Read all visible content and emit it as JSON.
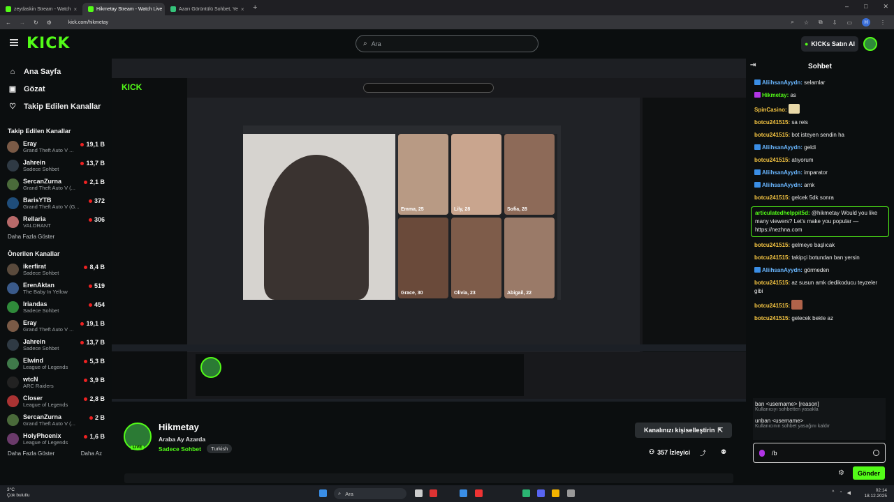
{
  "browser": {
    "tabs": [
      {
        "title": "zeydaskin Stream - Watch",
        "active": false,
        "color": "#53fc18"
      },
      {
        "title": "Hikmetay Stream - Watch Live",
        "active": true,
        "color": "#53fc18"
      },
      {
        "title": "Azarı Görüntülü Sohbet, Ye",
        "active": false,
        "color": "#35c37a"
      }
    ],
    "new_tab": "+",
    "url": "kick.com/hikmetay",
    "window_controls": [
      "–",
      "□",
      "✕"
    ]
  },
  "header": {
    "logo": "KICK",
    "search_placeholder": "Ara",
    "buy_kicks": "KICKs Satın Al"
  },
  "sidebar": {
    "nav": [
      {
        "label": "Ana Sayfa",
        "icon": "home-icon",
        "glyph": "⌂"
      },
      {
        "label": "Gözat",
        "icon": "browse-icon",
        "glyph": "▣"
      },
      {
        "label": "Takip Edilen Kanallar",
        "icon": "heart-icon",
        "glyph": "♡"
      }
    ],
    "followed_heading": "Takip Edilen Kanallar",
    "followed": [
      {
        "name": "Eray",
        "category": "Grand Theft Auto V ...",
        "viewers": "19,1 B",
        "color": "#7a5a46"
      },
      {
        "name": "Jahrein",
        "category": "Sadece Sohbet",
        "viewers": "13,7 B",
        "color": "#2f3a44"
      },
      {
        "name": "SercanZurna",
        "category": "Grand Theft Auto V (...",
        "viewers": "2,1 B",
        "color": "#4a6a3a"
      },
      {
        "name": "BarisYTB",
        "category": "Grand Theft Auto V (G...",
        "viewers": "372",
        "color": "#1f4d7a"
      },
      {
        "name": "Rellaria",
        "category": "VALORANT",
        "viewers": "306",
        "color": "#b86a6a"
      }
    ],
    "followed_more": "Daha Fazla Göster",
    "recommended_heading": "Önerilen Kanallar",
    "recommended": [
      {
        "name": "ikerfirat",
        "category": "Sadece Sohbet",
        "viewers": "8,4 B",
        "color": "#5a4a3c"
      },
      {
        "name": "ErenAktan",
        "category": "The Baby In Yellow",
        "viewers": "519",
        "color": "#3a5a8a"
      },
      {
        "name": "Iriandas",
        "category": "Sadece Sohbet",
        "viewers": "454",
        "color": "#2f8a3a"
      },
      {
        "name": "Eray",
        "category": "Grand Theft Auto V ...",
        "viewers": "19,1 B",
        "color": "#7a5a46"
      },
      {
        "name": "Jahrein",
        "category": "Sadece Sohbet",
        "viewers": "13,7 B",
        "color": "#2f3a44"
      },
      {
        "name": "Elwind",
        "category": "League of Legends",
        "viewers": "5,3 B",
        "color": "#3f7a4a"
      },
      {
        "name": "wtcN",
        "category": "ARC Raiders",
        "viewers": "3,9 B",
        "color": "#222"
      },
      {
        "name": "Closer",
        "category": "League of Legends",
        "viewers": "2,8 B",
        "color": "#a33"
      },
      {
        "name": "SercanZurna",
        "category": "Grand Theft Auto V (...",
        "viewers": "2 B",
        "color": "#4a6a3a"
      },
      {
        "name": "HolyPhoenix",
        "category": "League of Legends",
        "viewers": "1,6 B",
        "color": "#6a3a6a"
      }
    ],
    "recommended_more": "Daha Fazla Göster",
    "recommended_less": "Daha Az"
  },
  "stream": {
    "streamer": "Hikmetay",
    "title": "Araba Ay Azarda",
    "category": "Sadece Sohbet",
    "tag": "Turkish",
    "live": "LIVE",
    "personalize": "Kanalınızı kişiselleştirin",
    "viewers": "357 İzleyici",
    "inner_cards": [
      {
        "name": "Emma, 25"
      },
      {
        "name": "Lily, 28"
      },
      {
        "name": "Sofia, 28"
      },
      {
        "name": "Grace, 30"
      },
      {
        "name": "Olivia, 23"
      },
      {
        "name": "Abigail, 22"
      }
    ]
  },
  "chat": {
    "title": "Sohbet",
    "messages": [
      {
        "user": "AliihsanAyydn",
        "text": "selamlar",
        "color": "#6ab7ff",
        "badge": "#3a8ee6"
      },
      {
        "user": "Hikmetay",
        "text": "as",
        "color": "#53fc18",
        "badge": "#b235e6"
      },
      {
        "user": "SpinCasino",
        "text": "",
        "color": "#f5c542",
        "emote": true
      },
      {
        "user": "botcu241515",
        "text": "sa reis",
        "color": "#f5c542"
      },
      {
        "user": "botcu241515",
        "text": "bot isteyen sendin ha",
        "color": "#f5c542"
      },
      {
        "user": "AliihsanAyydn",
        "text": "geldi",
        "color": "#6ab7ff",
        "badge": "#3a8ee6"
      },
      {
        "user": "botcu241515",
        "text": "atıyorum",
        "color": "#f5c542"
      },
      {
        "user": "AliihsanAyydn",
        "text": "imparator",
        "color": "#6ab7ff",
        "badge": "#3a8ee6"
      },
      {
        "user": "AliihsanAyydn",
        "text": "amk",
        "color": "#6ab7ff",
        "badge": "#3a8ee6"
      },
      {
        "user": "botcu241515",
        "text": "gelcek 5dk sonra",
        "color": "#f5c542"
      },
      {
        "user": "articulatedhelppit5d",
        "text": "@hikmetay Would you like many viewers? Let's make you popular — https://nezhna.com",
        "color": "#53fc18",
        "highlight": true
      },
      {
        "user": "botcu241515",
        "text": "gelmeye başlıcak",
        "color": "#f5c542"
      },
      {
        "user": "botcu241515",
        "text": "takipçi botundan ban yersin",
        "color": "#f5c542"
      },
      {
        "user": "AliihsanAyydn",
        "text": "görmeden",
        "color": "#6ab7ff",
        "badge": "#3a8ee6"
      },
      {
        "user": "botcu241515",
        "text": "az susun amk dedikoducu teyzeler gibi",
        "color": "#f5c542"
      },
      {
        "user": "botcu241515",
        "text": "",
        "color": "#f5c542",
        "emote": true
      },
      {
        "user": "botcu241515",
        "text": "gelecek bekle az",
        "color": "#f5c542"
      }
    ],
    "suggestions": [
      {
        "cmd": "ban <username> [reason]",
        "desc": "Kullanıcıyı sohbetten yasakla"
      },
      {
        "cmd": "unban <username>",
        "desc": "Kullanıcının sohbet yasağını kaldır"
      }
    ],
    "input_value": "/b",
    "send": "Gönder"
  },
  "taskbar": {
    "weather_temp": "3°C",
    "weather_desc": "Çok bulutlu",
    "search": "Ara",
    "clock_time": "02:14",
    "clock_date": "18.12.2025"
  }
}
